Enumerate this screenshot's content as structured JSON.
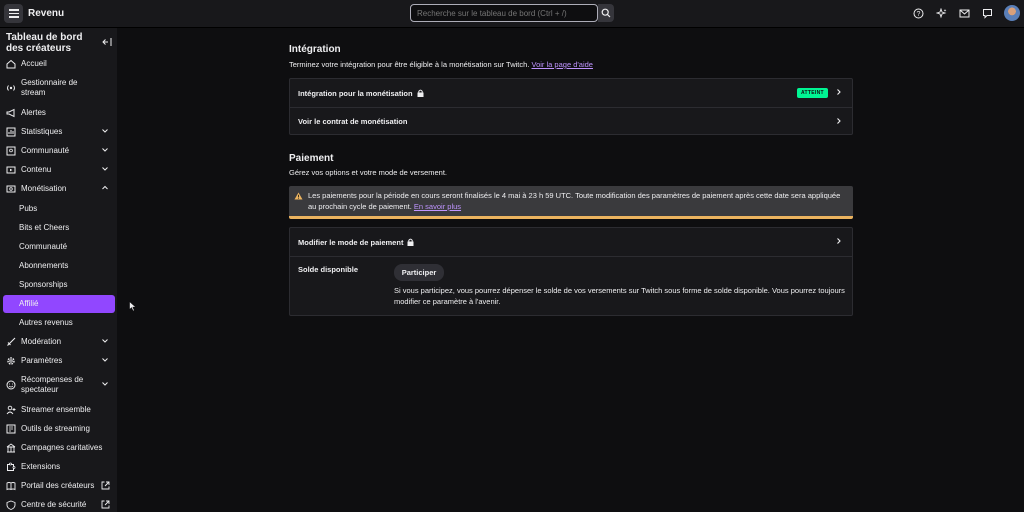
{
  "app": {
    "title": "Revenu"
  },
  "search": {
    "placeholder": "Recherche sur le tableau de bord (Ctrl + /)"
  },
  "top_icons": [
    "help-icon",
    "sparkles-icon",
    "inbox-icon",
    "whispers-icon",
    "avatar"
  ],
  "sidebar": {
    "title": "Tableau de bord des créateurs",
    "items": [
      {
        "label": "Accueil"
      },
      {
        "label": "Gestionnaire de stream"
      },
      {
        "label": "Alertes"
      },
      {
        "label": "Statistiques"
      },
      {
        "label": "Communauté"
      },
      {
        "label": "Contenu"
      },
      {
        "label": "Monétisation"
      },
      {
        "label": "Pubs"
      },
      {
        "label": "Bits et Cheers"
      },
      {
        "label": "Communauté"
      },
      {
        "label": "Abonnements"
      },
      {
        "label": "Sponsorships"
      },
      {
        "label": "Affilié"
      },
      {
        "label": "Autres revenus"
      },
      {
        "label": "Modération"
      },
      {
        "label": "Paramètres"
      },
      {
        "label": "Récompenses de spectateur"
      },
      {
        "label": "Streamer ensemble"
      },
      {
        "label": "Outils de streaming"
      },
      {
        "label": "Campagnes caritatives"
      },
      {
        "label": "Extensions"
      },
      {
        "label": "Portail des créateurs"
      },
      {
        "label": "Centre de sécurité"
      }
    ]
  },
  "integration": {
    "title": "Intégration",
    "desc": "Terminez votre intégration pour être éligible à la monétisation sur Twitch.",
    "help_link": "Voir la page d'aide",
    "row1_label": "Intégration pour la monétisation",
    "row1_badge": "ATTEINT",
    "row2_label": "Voir le contrat de monétisation"
  },
  "payment": {
    "title": "Paiement",
    "desc": "Gérez vos options et votre mode de versement.",
    "alert_text": "Les paiements pour la période en cours seront finalisés le 4 mai à 23 h 59 UTC. Toute modification des paramètres de paiement après cette date sera appliquée au prochain cycle de paiement.",
    "alert_link": "En savoir plus",
    "method_label": "Modifier le mode de paiement",
    "balance_label": "Solde disponible",
    "join_button": "Participer",
    "balance_desc": "Si vous participez, vous pourrez dépenser le solde de vos versements sur Twitch sous forme de solde disponible. Vous pourrez toujours modifier ce paramètre à l'avenir."
  },
  "colors": {
    "accent": "#9147ff",
    "badge": "#00f593",
    "warning": "#ebb35f",
    "link": "#bf94ff"
  }
}
